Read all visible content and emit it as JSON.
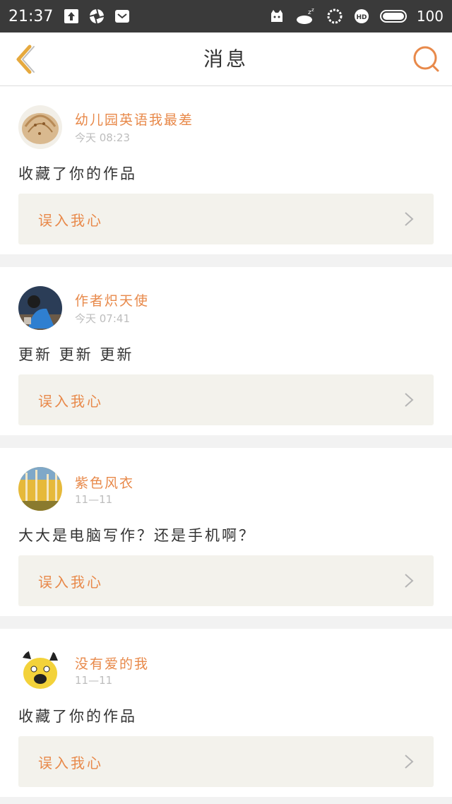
{
  "status": {
    "time": "21:37",
    "battery": "100"
  },
  "header": {
    "title": "消息"
  },
  "messages": [
    {
      "username": "幼儿园英语我最差",
      "time": "今天 08:23",
      "content": "收藏了你的作品",
      "work": "误入我心",
      "avatar": "shell"
    },
    {
      "username": "作者炽天使",
      "time": "今天 07:41",
      "content": "更新 更新 更新",
      "work": "误入我心",
      "avatar": "person"
    },
    {
      "username": "紫色风衣",
      "time": "11—11",
      "content": "大大是电脑写作？还是手机啊？",
      "work": "误入我心",
      "avatar": "trees"
    },
    {
      "username": "没有爱的我",
      "time": "11—11",
      "content": "收藏了你的作品",
      "work": "误入我心",
      "avatar": "pikachu"
    }
  ],
  "colors": {
    "accent": "#e8894a",
    "status_bar": "#3a3a3a",
    "link_bg": "#f3f2ec"
  }
}
